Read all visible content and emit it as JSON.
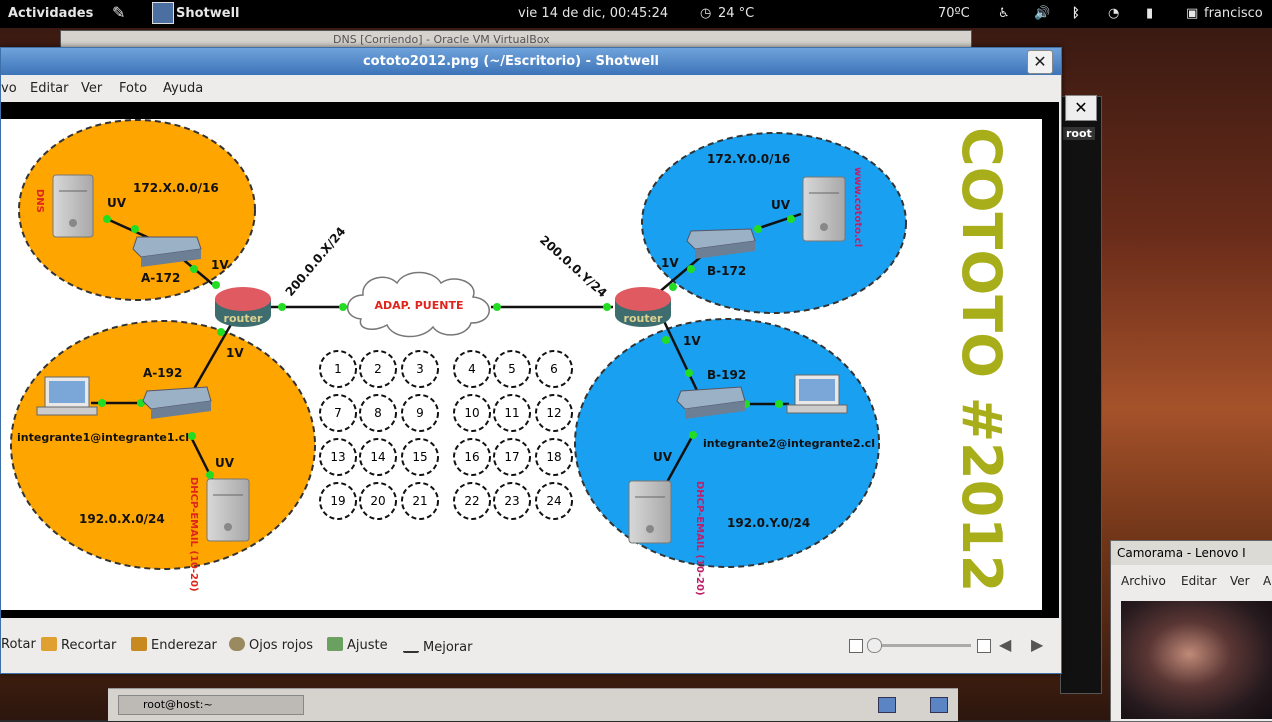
{
  "top_panel": {
    "activities": "Actividades",
    "app_name": "Shotwell",
    "datetime": "vie 14 de dic, 00:45:24",
    "weather": "24 °C",
    "cpu_temp": "70ºC",
    "user": "francisco"
  },
  "background_windows": {
    "behind_title": "DNS [Corriendo] - Oracle VM VirtualBox",
    "terminal_tab": "root",
    "taskbar_item": "root@host:~"
  },
  "window": {
    "title": "cototo2012.png (~/Escritorio) - Shotwell",
    "close_label": "✕"
  },
  "menu": [
    "vo",
    "Editar",
    "Ver",
    "Foto",
    "Ayuda"
  ],
  "toolbar": {
    "rotate": "Rotar",
    "crop": "Recortar",
    "straighten": "Enderezar",
    "red_eye": "Ojos rojos",
    "adjust": "Ajuste",
    "enhance": "Mejorar"
  },
  "camorama": {
    "title": "Camorama - Lenovo I",
    "menu": [
      "Archivo",
      "Editar",
      "Ver",
      "A"
    ]
  },
  "diagram": {
    "heading": "COTOTO #2012",
    "colors": {
      "orange": "#ffa500",
      "blue": "#1a9ff0",
      "heading": "#a8ad1a",
      "red_label": "#e0261c",
      "dot": "#22dd22"
    },
    "bridge": "ADAP. PUENTE",
    "left_wan": "200.0.0.X/24",
    "right_wan": "200.0.0.Y/24",
    "router_label": "router",
    "top_left": {
      "net": "172.X.0.0/16",
      "uv": "UV",
      "v1": "1V",
      "switch": "A-172",
      "server": "DNS"
    },
    "bottom_left": {
      "v1": "1V",
      "switch": "A-192",
      "host": "integrante1@integrante1.cl",
      "uv": "UV",
      "server": "DHCP-EMAIL (10-20)",
      "net": "192.0.X.0/24"
    },
    "top_right": {
      "net": "172.Y.0.0/16",
      "uv": "UV",
      "v1": "1V",
      "switch": "B-172",
      "server": "www.cototo.cl"
    },
    "bottom_right": {
      "v1": "1V",
      "switch": "B-192",
      "host": "integrante2@integrante2.cl",
      "uv": "UV",
      "server": "DHCP-EMAIL (10-20)",
      "net": "192.0.Y.0/24"
    },
    "numbers": [
      "1",
      "2",
      "3",
      "4",
      "5",
      "6",
      "7",
      "8",
      "9",
      "10",
      "11",
      "12",
      "13",
      "14",
      "15",
      "16",
      "17",
      "18",
      "19",
      "20",
      "21",
      "22",
      "23",
      "24"
    ]
  }
}
